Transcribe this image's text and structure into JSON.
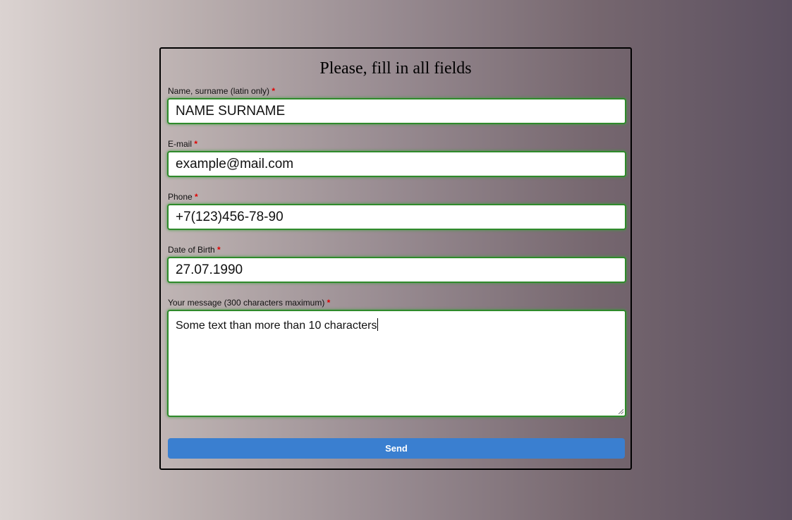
{
  "form": {
    "title": "Please, fill in all fields",
    "required_mark": "*",
    "fields": [
      {
        "label": "Name, surname (latin only)",
        "value": "NAME SURNAME"
      },
      {
        "label": "E-mail",
        "value": "example@mail.com"
      },
      {
        "label": "Phone",
        "value": "+7(123)456-78-90"
      },
      {
        "label": "Date of Birth",
        "value": "27.07.1990"
      }
    ],
    "message": {
      "label": "Your message (300 characters maximum)",
      "value": "Some text than more than 10 characters"
    },
    "send_label": "Send"
  },
  "colors": {
    "valid_border": "#2f8a2b",
    "required_mark": "#e00000",
    "button": "#3a7fd0"
  }
}
